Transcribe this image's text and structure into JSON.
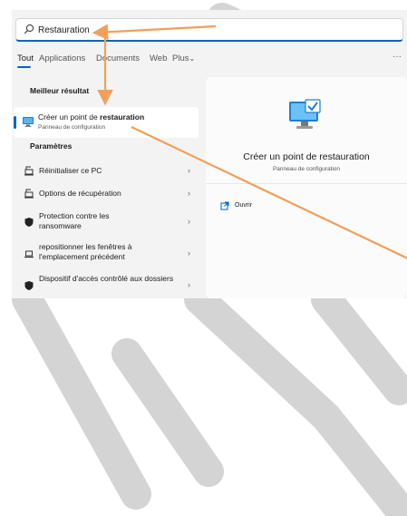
{
  "search": {
    "value": "Restauration"
  },
  "tabs": [
    {
      "label": "Tout"
    },
    {
      "label": "Applications"
    },
    {
      "label": "Documents"
    },
    {
      "label": "Web"
    },
    {
      "label": "Plus"
    }
  ],
  "more_label": "···",
  "best_match": {
    "heading": "Meilleur résultat",
    "title_prefix": "Créer un point de ",
    "title_bold": "restauration",
    "subtitle": "Panneau de configuration"
  },
  "settings": {
    "heading": "Paramètres",
    "items": [
      {
        "label": "Réinitialiser ce PC",
        "icon": "reset-pc-icon"
      },
      {
        "label": "Options de récupération",
        "icon": "recovery-icon"
      },
      {
        "label": "Protection contre les ransomware",
        "icon": "shield-icon"
      },
      {
        "label": "repositionner les fenêtres à l'emplacement précédent",
        "icon": "laptop-icon"
      },
      {
        "label": "Dispositif d'accès contrôlé aux dossiers",
        "icon": "shield-icon"
      }
    ]
  },
  "detail": {
    "title": "Créer un point de restauration",
    "subtitle": "Panneau de configuration",
    "open_label": "Ouvrir"
  },
  "colors": {
    "accent": "#0067c0",
    "annotation": "#f0a05a",
    "watermark": "#d4d4d4"
  }
}
